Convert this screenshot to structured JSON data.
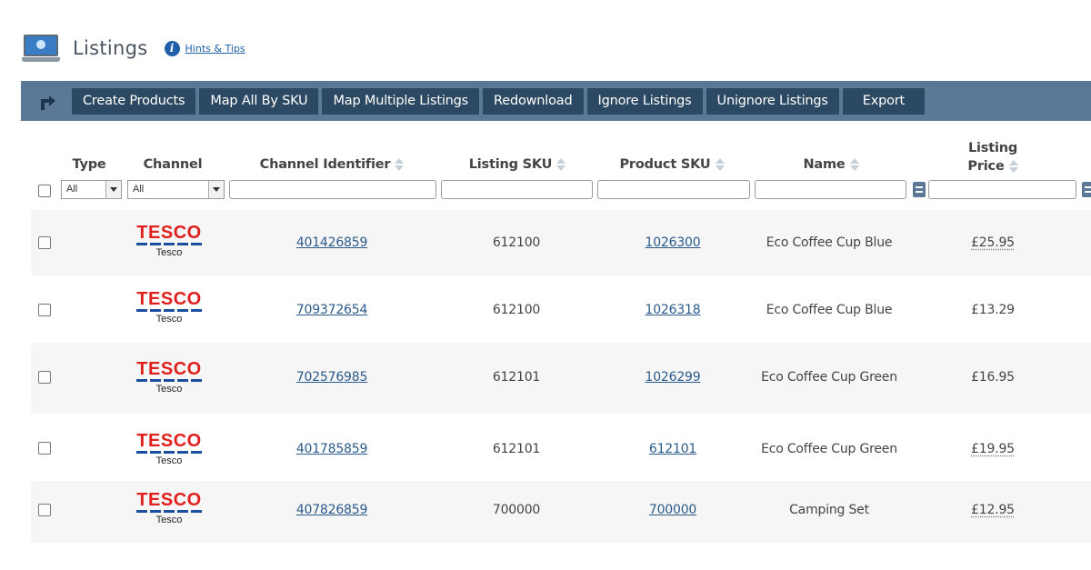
{
  "header": {
    "title": "Listings",
    "hints_label": "Hints & Tips"
  },
  "toolbar": {
    "buttons": [
      "Create Products",
      "Map All By SKU",
      "Map Multiple Listings",
      "Redownload",
      "Ignore Listings",
      "Unignore Listings",
      "Export"
    ]
  },
  "table": {
    "columns": {
      "type": "Type",
      "channel": "Channel",
      "channel_identifier": "Channel Identifier",
      "listing_sku": "Listing SKU",
      "product_sku": "Product SKU",
      "name": "Name",
      "listing_price_line1": "Listing",
      "listing_price_line2": "Price"
    },
    "filters": {
      "type_selected": "All",
      "channel_selected": "All"
    },
    "rows": [
      {
        "channel_logo": "TESCO",
        "channel_name": "Tesco",
        "channel_identifier": "401426859",
        "listing_sku": "612100",
        "product_sku": "1026300",
        "name": "Eco Coffee Cup Blue",
        "price": "£25.95"
      },
      {
        "channel_logo": "TESCO",
        "channel_name": "Tesco",
        "channel_identifier": "709372654",
        "listing_sku": "612100",
        "product_sku": "1026318",
        "name": "Eco Coffee Cup Blue",
        "price": "£13.29"
      },
      {
        "channel_logo": "TESCO",
        "channel_name": "Tesco",
        "channel_identifier": "702576985",
        "listing_sku": "612101",
        "product_sku": "1026299",
        "name": "Eco Coffee Cup Green",
        "price": "£16.95"
      },
      {
        "channel_logo": "TESCO",
        "channel_name": "Tesco",
        "channel_identifier": "401785859",
        "listing_sku": "612101",
        "product_sku": "612101",
        "name": "Eco Coffee Cup Green",
        "price": "£19.95"
      },
      {
        "channel_logo": "TESCO",
        "channel_name": "Tesco",
        "channel_identifier": "407826859",
        "listing_sku": "700000",
        "product_sku": "700000",
        "name": "Camping Set",
        "price": "£12.95"
      }
    ]
  },
  "colors": {
    "toolbar_bg": "#5b7896",
    "button_bg": "#2c4963",
    "link": "#2a5a8a",
    "tesco_red": "#e0201f",
    "tesco_blue": "#1a4fa0"
  },
  "icons": {
    "page": "listings-monitor-icon",
    "info": "info-icon",
    "back": "back-arrow-icon",
    "sort": "sort-icon",
    "filter_operator": "filter-operator-icon"
  }
}
